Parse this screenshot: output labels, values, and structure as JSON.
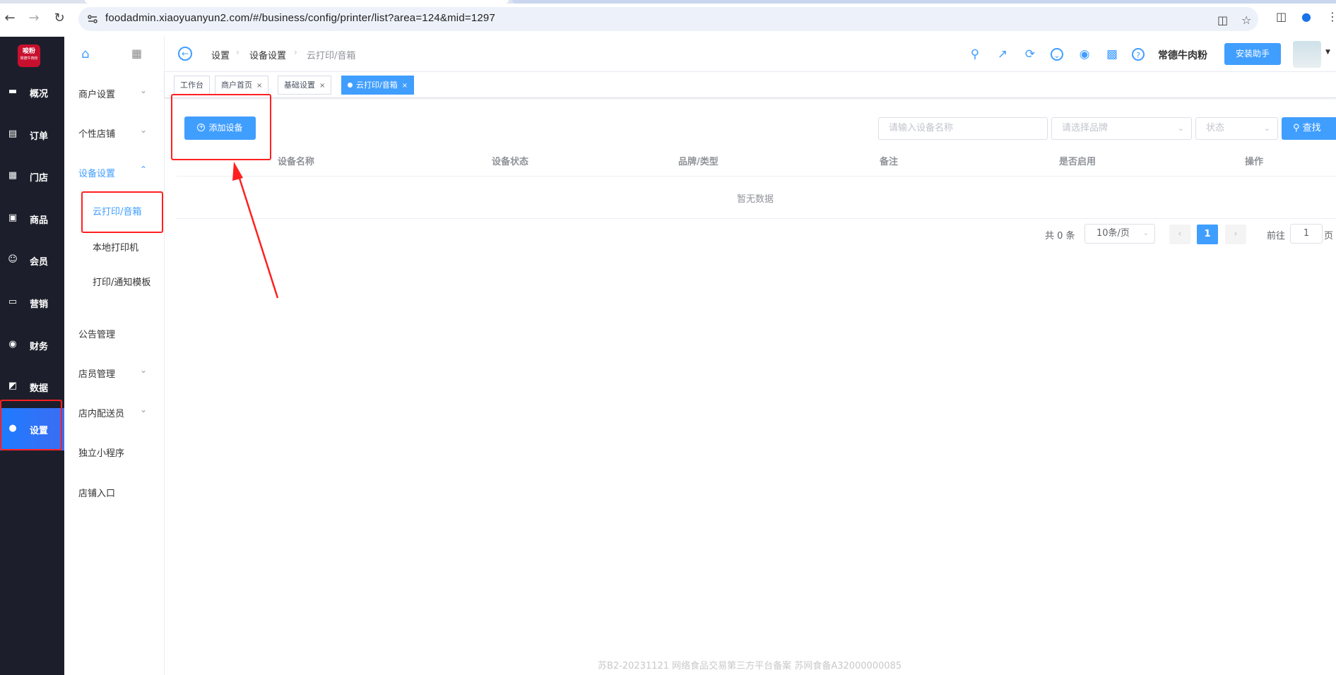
{
  "browser": {
    "url": "foodadmin.xiaoyuanyun2.com/#/business/config/printer/list?area=124&mid=1297"
  },
  "logo": {
    "text": "唆粉",
    "sub": "常德牛肉粉"
  },
  "main_nav": [
    {
      "label": "概况",
      "icon": "dashboard-icon"
    },
    {
      "label": "订单",
      "icon": "order-icon"
    },
    {
      "label": "门店",
      "icon": "store-icon"
    },
    {
      "label": "商品",
      "icon": "goods-icon"
    },
    {
      "label": "会员",
      "icon": "member-icon"
    },
    {
      "label": "营销",
      "icon": "marketing-icon"
    },
    {
      "label": "财务",
      "icon": "finance-icon"
    },
    {
      "label": "数据",
      "icon": "data-icon"
    },
    {
      "label": "设置",
      "icon": "settings-icon",
      "active": true
    }
  ],
  "sub_nav": {
    "items": [
      {
        "label": "商户设置",
        "expandable": true
      },
      {
        "label": "个性店铺",
        "expandable": true
      },
      {
        "label": "设备设置",
        "expandable": true,
        "open": true
      },
      {
        "label": "公告管理"
      },
      {
        "label": "店员管理",
        "expandable": true
      },
      {
        "label": "店内配送员",
        "expandable": true
      },
      {
        "label": "独立小程序"
      },
      {
        "label": "店铺入口"
      }
    ],
    "children": [
      {
        "label": "云打印/音箱",
        "active": true
      },
      {
        "label": "本地打印机"
      },
      {
        "label": "打印/通知模板"
      }
    ]
  },
  "breadcrumb": [
    "设置",
    "设备设置",
    "云打印/音箱"
  ],
  "header": {
    "shop_name": "常德牛肉粉",
    "install_label": "安装助手"
  },
  "tabs": [
    {
      "label": "工作台",
      "closable": false
    },
    {
      "label": "商户首页",
      "closable": true
    },
    {
      "label": "基础设置",
      "closable": true
    },
    {
      "label": "云打印/音箱",
      "closable": true,
      "active": true
    }
  ],
  "toolbar": {
    "add_label": "添加设备",
    "name_placeholder": "请输入设备名称",
    "brand_placeholder": "请选择品牌",
    "status_placeholder": "状态",
    "search_label": "查找"
  },
  "table": {
    "columns": [
      "设备名称",
      "设备状态",
      "品牌/类型",
      "备注",
      "是否启用",
      "操作"
    ],
    "empty_text": "暂无数据"
  },
  "pagination": {
    "total": "共 0 条",
    "page_size": "10条/页",
    "current_page": "1",
    "goto_label": "前往",
    "goto_value": "1",
    "page_suffix": "页"
  },
  "footer": "苏B2-20231121   网络食品交易第三方平台备案 苏网食备A32000000085",
  "colors": {
    "accent": "#409eff",
    "sidebar": "#1c1f2b",
    "annotation": "#ff2020"
  }
}
